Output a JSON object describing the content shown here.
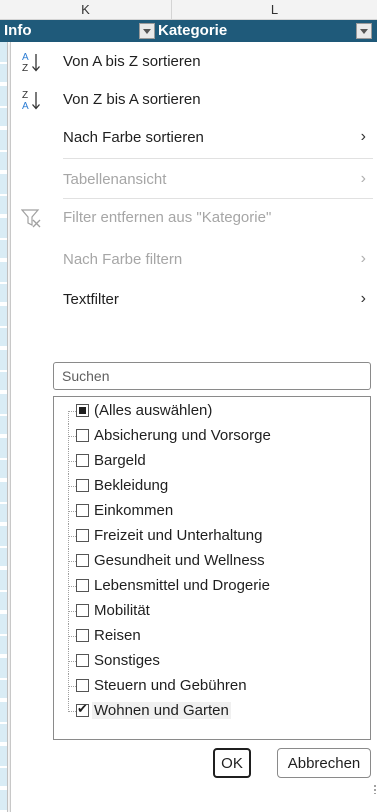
{
  "columns": {
    "k": "K",
    "l": "L"
  },
  "table_header": {
    "info": "Info",
    "kategorie": "Kategorie"
  },
  "menu": {
    "sort_az": "Von A bis Z sortieren",
    "sort_za": "Von Z bis A sortieren",
    "sort_color": "Nach Farbe sortieren",
    "table_view": "Tabellenansicht",
    "clear_filter": "Filter entfernen aus \"Kategorie\"",
    "filter_color": "Nach Farbe filtern",
    "text_filter": "Textfilter"
  },
  "search": {
    "placeholder": "Suchen"
  },
  "list": [
    {
      "label": "(Alles auswählen)",
      "state": "partial"
    },
    {
      "label": "Absicherung und Vorsorge",
      "state": "unchecked"
    },
    {
      "label": "Bargeld",
      "state": "unchecked"
    },
    {
      "label": "Bekleidung",
      "state": "unchecked"
    },
    {
      "label": "Einkommen",
      "state": "unchecked"
    },
    {
      "label": "Freizeit und Unterhaltung",
      "state": "unchecked"
    },
    {
      "label": "Gesundheit und Wellness",
      "state": "unchecked"
    },
    {
      "label": "Lebensmittel und Drogerie",
      "state": "unchecked"
    },
    {
      "label": "Mobilität",
      "state": "unchecked"
    },
    {
      "label": "Reisen",
      "state": "unchecked"
    },
    {
      "label": "Sonstiges",
      "state": "unchecked"
    },
    {
      "label": "Steuern und Gebühren",
      "state": "unchecked"
    },
    {
      "label": "Wohnen und Garten",
      "state": "checked"
    }
  ],
  "buttons": {
    "ok": "OK",
    "cancel": "Abbrechen"
  },
  "colors": {
    "header_bg": "#1f5a7a",
    "header_text": "#ffffff",
    "disabled_text": "#a6a6a6"
  },
  "icons": {
    "sort_az": "sort-ascending-icon",
    "sort_za": "sort-descending-icon",
    "clear_filter": "filter-clear-icon",
    "submenu": "chevron-right-icon"
  }
}
